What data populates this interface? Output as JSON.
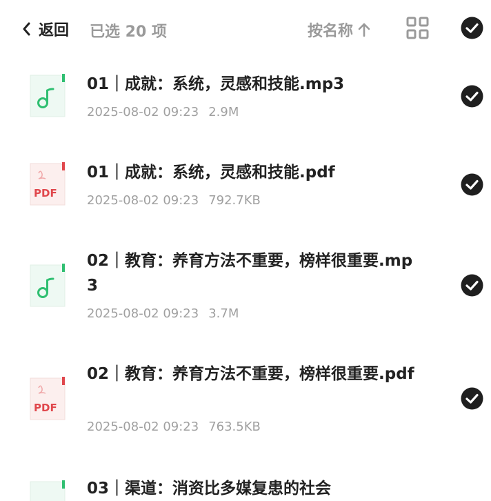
{
  "header": {
    "back_label": "返回",
    "selected_text": "已选 20 项",
    "sort_label": "按名称",
    "icons": {
      "back": "chevron-left-icon",
      "sort": "arrow-up-icon",
      "view": "grid-view-icon",
      "select_all": "check-circle-icon"
    }
  },
  "files": [
    {
      "name": "01｜成就：系统，灵感和技能.mp3",
      "date": "2025-08-02 09:23",
      "size": "2.9M",
      "type": "audio",
      "selected": true
    },
    {
      "name": "01｜成就：系统，灵感和技能.pdf",
      "date": "2025-08-02 09:23",
      "size": "792.7KB",
      "type": "pdf",
      "selected": true
    },
    {
      "name": "02｜教育：养育方法不重要，榜样很重要.mp3",
      "date": "2025-08-02 09:23",
      "size": "3.7M",
      "type": "audio",
      "selected": true
    },
    {
      "name": "02｜教育：养育方法不重要，榜样很重要.pdf",
      "date": "2025-08-02 09:23",
      "size": "763.5KB",
      "type": "pdf",
      "selected": true
    },
    {
      "name": "03｜渠道：消资比多媒复患的社会",
      "date": "",
      "size": "",
      "type": "audio",
      "selected": true
    }
  ],
  "pdf_badge": "PDF",
  "colors": {
    "audio_green": "#2fbf71",
    "pdf_red": "#e0474c",
    "check_dark": "#1f1f1f"
  }
}
